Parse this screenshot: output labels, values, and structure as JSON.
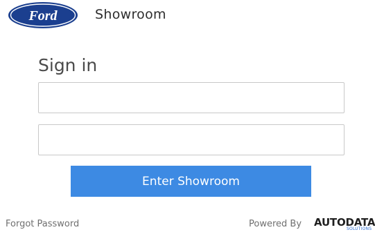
{
  "header": {
    "logo_text": "Ford",
    "title": "Showroom"
  },
  "form": {
    "heading": "Sign in",
    "username": {
      "value": "",
      "placeholder": ""
    },
    "password": {
      "value": "",
      "placeholder": ""
    },
    "submit_label": "Enter Showroom"
  },
  "footer": {
    "forgot_label": "Forgot Password",
    "powered_by": "Powered By",
    "brand": "AUTODATA",
    "brand_sub": "SOLUTIONS"
  },
  "colors": {
    "ford_blue": "#1b3f8f",
    "button_blue": "#3d8ae3"
  }
}
